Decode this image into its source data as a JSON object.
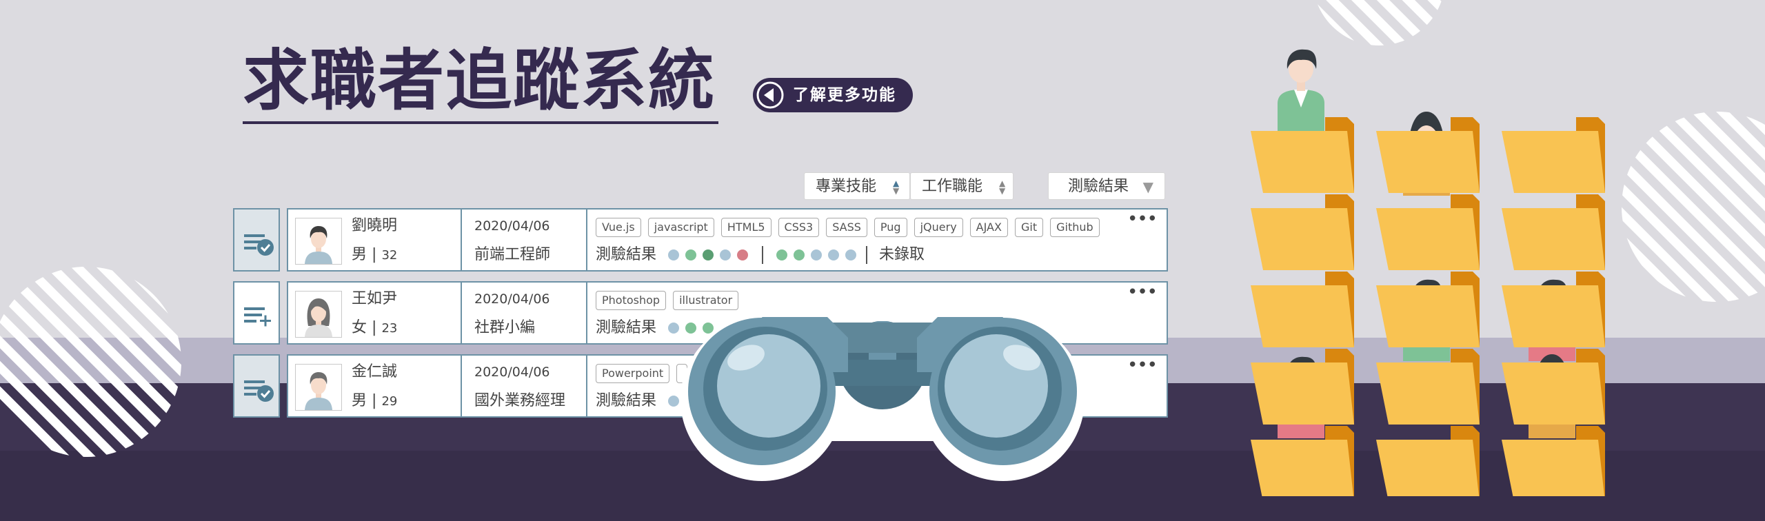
{
  "header": {
    "title": "求職者追蹤系統",
    "more_button_label": "了解更多功能"
  },
  "sort_controls": {
    "skill_label": "專業技能",
    "job_label": "工作職能",
    "result_label": "測驗結果",
    "sort_up": "▲",
    "sort_down": "▼",
    "dropdown_arrow": "▼"
  },
  "candidates": [
    {
      "name": "劉曉明",
      "gender": "男",
      "separator": "|",
      "age": "32",
      "date": "2020/04/06",
      "job": "前端工程師",
      "tags": [
        "Vue.js",
        "javascript",
        "HTML5",
        "CSS3",
        "SASS",
        "Pug",
        "jQuery",
        "AJAX",
        "Git",
        "Github"
      ],
      "result_label": "測驗結果",
      "status": "未錄取",
      "more": "•••"
    },
    {
      "name": "王如尹",
      "gender": "女",
      "separator": "|",
      "age": "23",
      "date": "2020/04/06",
      "job": "社群小編",
      "tags": [
        "Photoshop",
        "illustrator"
      ],
      "result_label": "測驗結果",
      "more": "•••"
    },
    {
      "name": "金仁誠",
      "gender": "男",
      "separator": "|",
      "age": "29",
      "date": "2020/04/06",
      "job": "國外業務經理",
      "tags": [
        "Powerpoint"
      ],
      "result_label": "測驗結果",
      "more": "•••"
    }
  ],
  "icons": {
    "row_1": "list-check-icon",
    "row_2": "list-add-icon",
    "row_3": "list-check-icon",
    "more": "back-arrow-circle-icon",
    "binoculars": "binoculars-icon"
  },
  "colors": {
    "title": "#352a4f",
    "border": "#6d92a6",
    "folder": "#f9c352",
    "folder_back": "#d9870f",
    "dot_light_blue": "#a9c4d6",
    "dot_green": "#7ec296",
    "dot_dark_green": "#5a9e72",
    "dot_red": "#d77d86"
  }
}
